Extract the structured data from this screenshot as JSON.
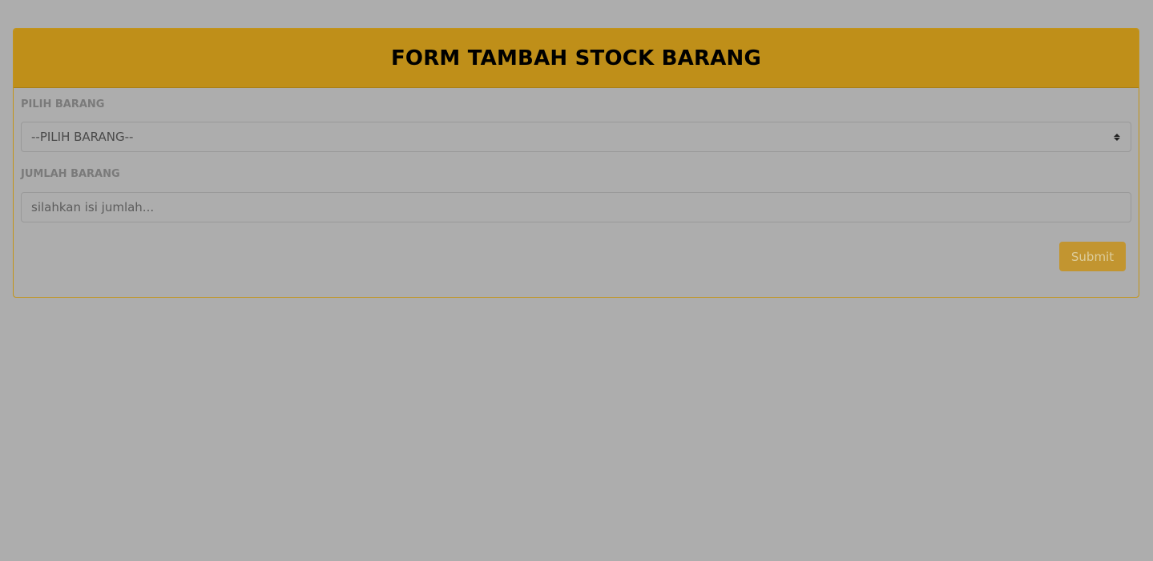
{
  "form": {
    "title": "FORM TAMBAH STOCK BARANG",
    "pilih_barang": {
      "label": "PILIH BARANG",
      "selected": "--PILIH BARANG--"
    },
    "jumlah_barang": {
      "label": "JUMLAH BARANG",
      "placeholder": "silahkan isi jumlah...",
      "value": ""
    },
    "submit_label": "Submit"
  },
  "colors": {
    "overlay_background": "#adadad",
    "header_background": "#bf8f19",
    "button_background": "#c29530"
  },
  "icons": {
    "select_caret": "chevron-up-down-icon"
  }
}
